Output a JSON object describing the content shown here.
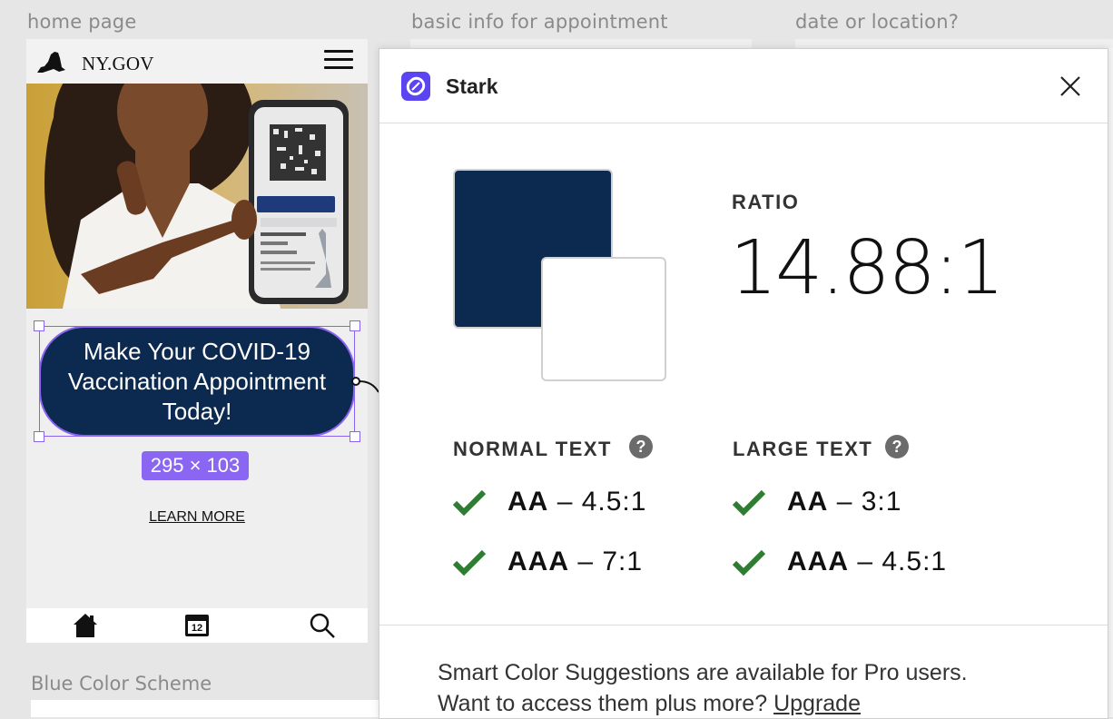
{
  "frames": {
    "home_label": "home page",
    "basic_label": "basic info for appointment",
    "date_label": "date or location?",
    "scheme_label": "Blue Color Scheme"
  },
  "phone": {
    "site_name": "NY.GOV",
    "cta_line1": "Make Your COVID-19",
    "cta_line2": "Vaccination Appointment",
    "cta_line3": "Today!",
    "size_badge": "295 × 103",
    "learn_more": "LEARN MORE",
    "calendar_day": "12",
    "cta_color": "#0c2a50",
    "selection_color": "#8a63f0"
  },
  "stark": {
    "title": "Stark",
    "ratio_label": "RATIO",
    "ratio_value": "14.88:1",
    "foreground": "#0c2a50",
    "background": "#ffffff",
    "normal_label": "NORMAL TEXT",
    "large_label": "LARGE TEXT",
    "normal_aa_level": "AA",
    "normal_aa_ratio": "– 4.5:1",
    "normal_aaa_level": "AAA",
    "normal_aaa_ratio": "– 7:1",
    "large_aa_level": "AA",
    "large_aa_ratio": "– 3:1",
    "large_aaa_level": "AAA",
    "large_aaa_ratio": "– 4.5:1",
    "suggest_line1": "Smart Color Suggestions are available for Pro users.",
    "suggest_line2": "Want to access them plus more?",
    "upgrade": "Upgrade",
    "check_color": "#2e7d32"
  }
}
